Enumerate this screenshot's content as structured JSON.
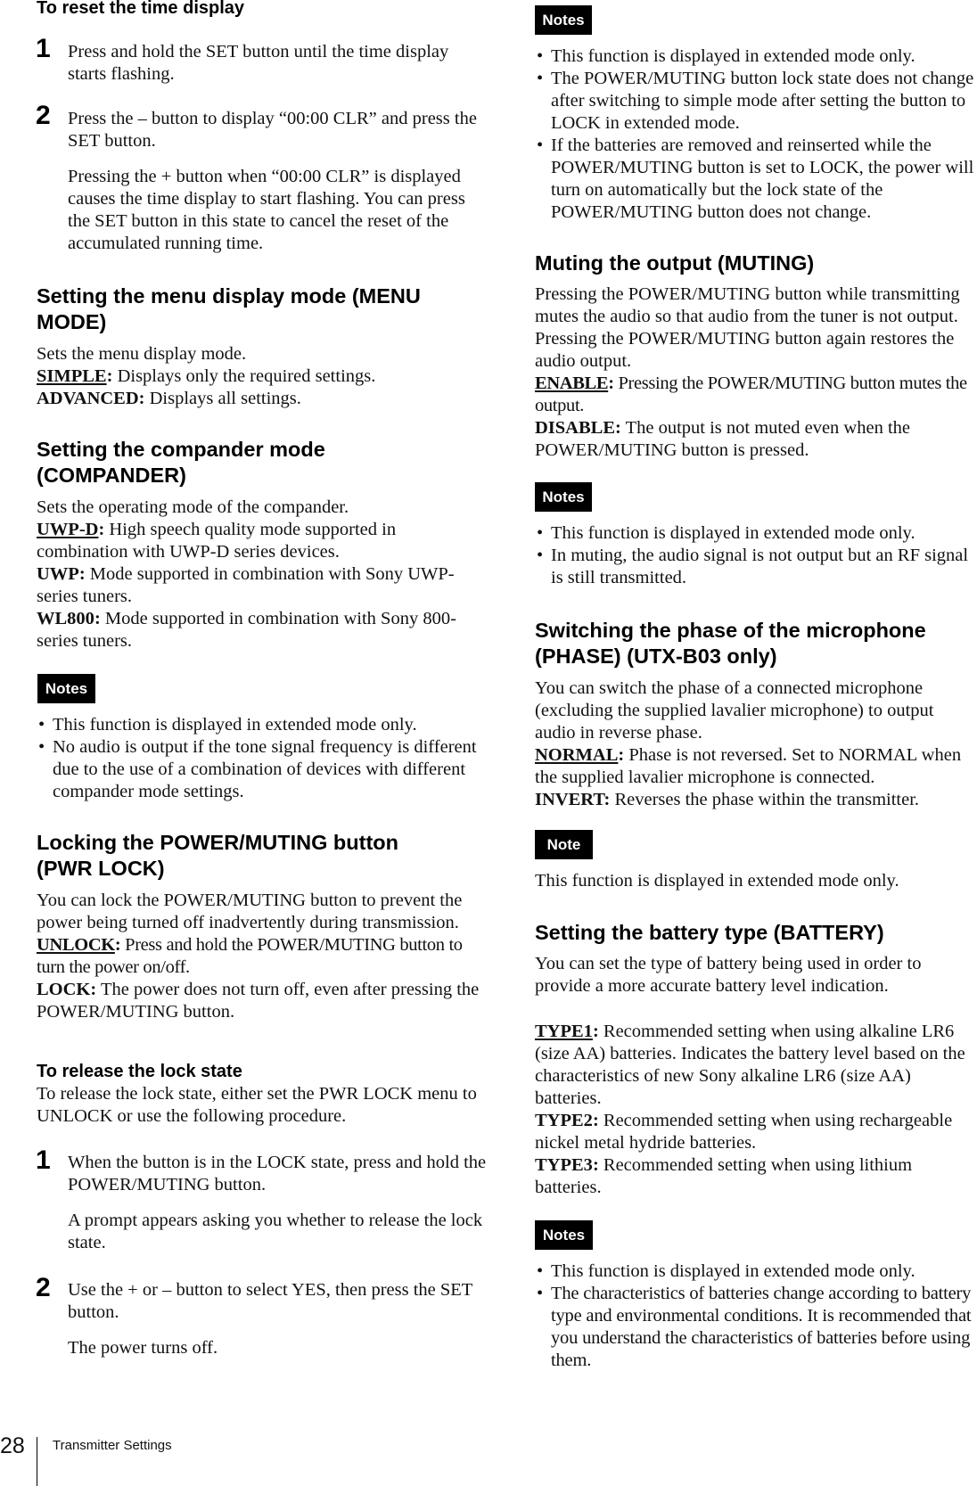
{
  "left": {
    "reset": {
      "heading": "To reset the time display",
      "steps": [
        {
          "num": "1",
          "text": "Press and hold the SET button until the time display starts flashing."
        },
        {
          "num": "2",
          "text": "Press the – button to display “00:00 CLR” and press the SET button.",
          "sub": "Pressing the + button when “00:00 CLR” is displayed causes the time display to start flashing. You can press the SET button in this state to cancel the reset of the accumulated running time."
        }
      ]
    },
    "menu_mode": {
      "heading": "Setting the menu display mode (MENU MODE)",
      "intro": "Sets the menu display mode.",
      "options": [
        {
          "key": "SIMPLE",
          "desc": " Displays only the required settings.",
          "default": true
        },
        {
          "key": "ADVANCED",
          "desc": " Displays all settings.",
          "default": false
        }
      ]
    },
    "compander": {
      "heading": "Setting the compander mode (COMPANDER)",
      "intro": "Sets the operating mode of the compander.",
      "options": [
        {
          "key": "UWP-D",
          "desc": " High speech quality mode supported in combination with UWP-D series devices.",
          "default": true
        },
        {
          "key": "UWP",
          "desc": " Mode supported in combination with Sony UWP-series tuners.",
          "default": false
        },
        {
          "key": "WL800",
          "desc": " Mode supported in combination with Sony 800-series tuners.",
          "default": false
        }
      ],
      "notes_label": "Notes",
      "notes": [
        "This function is displayed in extended mode only.",
        "No audio is output if the tone signal frequency is different due to the use of a combination of devices with different compander mode settings."
      ]
    },
    "pwr_lock": {
      "heading": "Locking the POWER/MUTING button (PWR LOCK)",
      "intro": "You can lock the POWER/MUTING button to prevent the power being turned off inadvertently during transmission.",
      "options": [
        {
          "key": "UNLOCK",
          "desc": " Press and hold the POWER/MUTING button to turn the power on/off.",
          "default": true
        },
        {
          "key": "LOCK",
          "desc": " The power does not turn off, even after pressing the POWER/MUTING button.",
          "default": false
        }
      ],
      "release": {
        "heading": "To release the lock state",
        "intro": "To release the lock state, either set the PWR LOCK menu to UNLOCK or use the following procedure.",
        "steps": [
          {
            "num": "1",
            "text": "When the button is in the LOCK state, press and hold the POWER/MUTING button.",
            "sub": "A prompt appears asking you whether to release the lock state."
          },
          {
            "num": "2",
            "text": "Use the + or – button to select YES, then press the SET button.",
            "sub": "The power turns off."
          }
        ]
      }
    }
  },
  "right": {
    "pwr_lock_notes": {
      "notes_label": "Notes",
      "notes": [
        "This function is displayed in extended mode only.",
        "The POWER/MUTING button lock state does not change after switching to simple mode after setting the button to LOCK in extended mode.",
        "If the batteries are removed and reinserted while the POWER/MUTING button is set to LOCK, the power will turn on automatically but the lock state of the POWER/MUTING button does not change."
      ]
    },
    "muting": {
      "heading": "Muting the output (MUTING)",
      "intro": "Pressing the POWER/MUTING button while transmitting mutes the audio so that audio from the tuner is not output. Pressing the POWER/MUTING button again restores the audio output.",
      "options": [
        {
          "key": "ENABLE",
          "desc": " Pressing the POWER/MUTING button mutes the output.",
          "default": true
        },
        {
          "key": "DISABLE",
          "desc": " The output is not muted even when the POWER/MUTING button is pressed.",
          "default": false
        }
      ],
      "notes_label": "Notes",
      "notes": [
        "This function is displayed in extended mode only.",
        "In muting, the audio signal is not output but an RF signal is still transmitted."
      ]
    },
    "phase": {
      "heading": "Switching the phase of the microphone (PHASE) (UTX-B03 only)",
      "intro": "You can switch the phase of a connected microphone (excluding the supplied lavalier microphone) to output audio in reverse phase.",
      "options": [
        {
          "key": "NORMAL",
          "desc": " Phase is not reversed. Set to NORMAL when the supplied lavalier microphone is connected.",
          "default": true
        },
        {
          "key": "INVERT",
          "desc": " Reverses the phase within the transmitter.",
          "default": false
        }
      ],
      "note_label": "Note",
      "note": "This function is displayed in extended mode only."
    },
    "battery": {
      "heading": "Setting the battery type (BATTERY)",
      "intro": "You can set the type of battery being used in order to provide a more accurate battery level indication.",
      "options": [
        {
          "key": "TYPE1",
          "desc": " Recommended setting when using alkaline LR6 (size AA) batteries. Indicates the battery level based on the characteristics of new Sony alkaline LR6 (size AA) batteries.",
          "default": true
        },
        {
          "key": "TYPE2",
          "desc": " Recommended setting when using rechargeable nickel metal hydride batteries.",
          "default": false
        },
        {
          "key": "TYPE3",
          "desc": " Recommended setting when using lithium batteries.",
          "default": false
        }
      ],
      "notes_label": "Notes",
      "notes": [
        "This function is displayed in extended mode only.",
        "The characteristics of batteries change according to battery type and environmental conditions. It is recommended that you understand the characteristics of batteries before using them."
      ]
    }
  },
  "footer": {
    "page_number": "28",
    "section_title": "Transmitter Settings"
  }
}
